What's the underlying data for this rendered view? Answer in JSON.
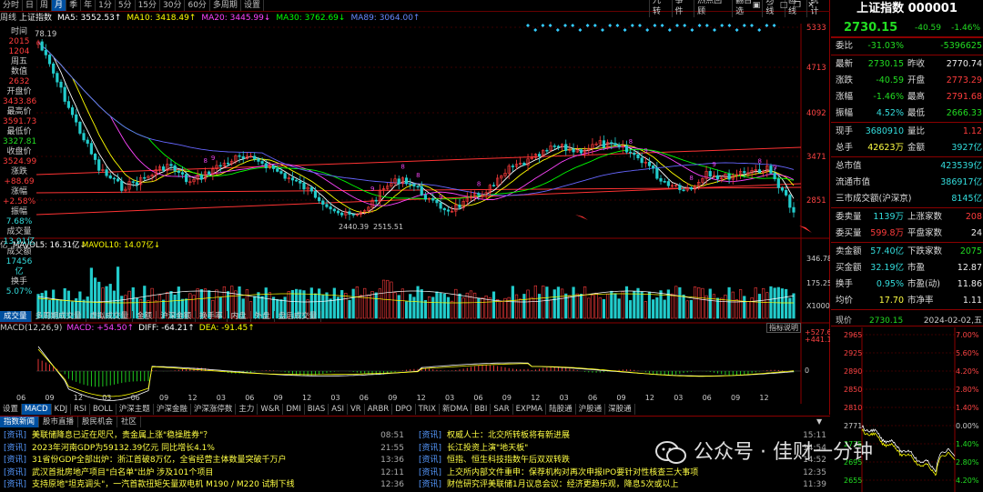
{
  "period_tabs": [
    "分时",
    "日",
    "周",
    "月",
    "季",
    "年",
    "1分",
    "5分",
    "15分",
    "30分",
    "60分",
    "多周期",
    "设置"
  ],
  "period_active": 3,
  "top_tools": [
    "九转",
    "事件",
    "热点回顾",
    "翻自选",
    "均线",
    "画线",
    "统计"
  ],
  "window_icons": [
    "menu-icon",
    "minimize-icon",
    "maximize-icon",
    "restore-icon",
    "close-icon"
  ],
  "ma_legend": {
    "prefix": "周线",
    "title": "上证指数",
    "ma5": "MA5: 3552.53↑",
    "ma10": "MA10: 3418.49↑",
    "ma20": "MA20: 3445.99↓",
    "ma30": "MA30: 3762.69↓",
    "ma89": "MA89: 3064.00↑"
  },
  "info_panel": [
    {
      "label": "时间",
      "value": "2015"
    },
    {
      "label": "",
      "value": "1204"
    },
    {
      "label": "周五",
      "value": ""
    },
    {
      "label": "数值",
      "value": "2632"
    },
    {
      "label": "开盘价",
      "value": "3433.86"
    },
    {
      "label": "最高价",
      "value": "3591.73"
    },
    {
      "label": "最低价",
      "value": "3327.81"
    },
    {
      "label": "收盘价",
      "value": "3524.99"
    },
    {
      "label": "涨跌",
      "value": "+88.69"
    },
    {
      "label": "涨幅",
      "value": "+2.58%"
    },
    {
      "label": "振幅",
      "value": "7.68%"
    },
    {
      "label": "成交量",
      "value": "13.91亿"
    },
    {
      "label": "成交额",
      "value": "17456亿"
    },
    {
      "label": "换手",
      "value": "5.07%"
    }
  ],
  "price_axis": [
    "5333",
    "4713",
    "4092",
    "3471",
    "2851"
  ],
  "price_top_label": "78.19",
  "low_label": "2440.39",
  "low_label2": "2515.51",
  "vol_legend": {
    "prefix": "亿",
    "mavol5": "MAVOL5: 16.31亿↓",
    "mavol10": "MAVOL10: 14.07亿↓"
  },
  "vol_axis": [
    "346.78",
    "175.25"
  ],
  "vol_unit": "X1000",
  "indicator_tabs": [
    "成交量",
    "多周期成交量",
    "虚拟成交量",
    "金额",
    "沪深金额",
    "换手率",
    "内盘",
    "外盘",
    "盘后成交量"
  ],
  "macd_legend": {
    "name": "MACD(12,26,9)",
    "macd": "MACD: +54.50↑",
    "diff": "DIFF: -64.21↑",
    "dea": "DEA: -91.45↑"
  },
  "macd_axis": [
    "+527.6",
    "+441.1",
    "0"
  ],
  "indicator_button": "指标说明",
  "x_axis_labels": [
    "06",
    "09",
    "12",
    "03",
    "06",
    "09",
    "12",
    "03",
    "06",
    "09",
    "12",
    "03",
    "06",
    "09",
    "12",
    "03",
    "06",
    "09",
    "12",
    "03",
    "06",
    "09",
    "12",
    "03",
    "06",
    "09",
    "12"
  ],
  "bottom_tabs": [
    "设置",
    "MACD",
    "KDJ",
    "RSI",
    "BOLL",
    "沪深主题",
    "沪深金融",
    "沪深涨停数",
    "主力",
    "W&R",
    "DMI",
    "BIAS",
    "ASI",
    "VR",
    "ARBR",
    "DPO",
    "TRIX",
    "新DMA",
    "BBI",
    "SAR",
    "EXPMA",
    "陆股通",
    "沪股通",
    "深股通"
  ],
  "bottom_active": 1,
  "right_panel": {
    "title": "上证指数 000001",
    "price": "2730.15",
    "change": "-40.59",
    "change_pct": "-1.46%",
    "rows": [
      {
        "l": "委比",
        "v1": "-31.03%",
        "c1": "grn",
        "l2": "",
        "v2": "-5396625",
        "c2": "grn"
      },
      {
        "l": "最新",
        "v1": "2730.15",
        "c1": "grn",
        "l2": "昨收",
        "v2": "2770.74",
        "c2": "wht"
      },
      {
        "l": "涨跌",
        "v1": "-40.59",
        "c1": "grn",
        "l2": "开盘",
        "v2": "2773.29",
        "c2": "red"
      },
      {
        "l": "涨幅",
        "v1": "-1.46%",
        "c1": "grn",
        "l2": "最高",
        "v2": "2791.68",
        "c2": "red"
      },
      {
        "l": "振幅",
        "v1": "4.52%",
        "c1": "cyan",
        "l2": "最低",
        "v2": "2666.33",
        "c2": "grn"
      },
      {
        "l": "现手",
        "v1": "3680910",
        "c1": "cyan",
        "l2": "量比",
        "v2": "1.12",
        "c2": "red"
      },
      {
        "l": "总手",
        "v1": "42623万",
        "c1": "yel",
        "l2": "金额",
        "v2": "3927亿",
        "c2": "cyan"
      },
      {
        "l": "总市值",
        "v1": "",
        "c1": "wht",
        "l2": "",
        "v2": "423539亿",
        "c2": "cyan"
      },
      {
        "l": "流通市值",
        "v1": "",
        "c1": "wht",
        "l2": "",
        "v2": "386917亿",
        "c2": "cyan"
      },
      {
        "l": "三市成交额(沪深京)",
        "v1": "",
        "c1": "wht",
        "l2": "",
        "v2": "8145亿",
        "c2": "cyan"
      },
      {
        "l": "委卖量",
        "v1": "1139万",
        "c1": "cyan",
        "l2": "上涨家数",
        "v2": "208",
        "c2": "red"
      },
      {
        "l": "委买量",
        "v1": "599.8万",
        "c1": "red",
        "l2": "平盘家数",
        "v2": "24",
        "c2": "wht"
      },
      {
        "l": "卖金额",
        "v1": "57.40亿",
        "c1": "cyan",
        "l2": "下跌家数",
        "v2": "2075",
        "c2": "grn"
      },
      {
        "l": "买金额",
        "v1": "32.19亿",
        "c1": "cyan",
        "l2": "市盈",
        "v2": "12.87",
        "c2": "wht"
      },
      {
        "l": "换手",
        "v1": "0.95%",
        "c1": "cyan",
        "l2": "市盈(动)",
        "v2": "11.86",
        "c2": "wht"
      },
      {
        "l": "均价",
        "v1": "17.70",
        "c1": "yel",
        "l2": "市净率",
        "v2": "1.11",
        "c2": "wht"
      }
    ],
    "mini_header": {
      "l": "现价",
      "v": "2730.15",
      "date": "2024-02-02,五"
    },
    "mini_left": [
      "2965",
      "2925",
      "2890",
      "2850",
      "2810",
      "2771",
      "2735",
      "2695",
      "2655"
    ],
    "mini_right": [
      "7.00%",
      "5.60%",
      "4.20%",
      "2.80%",
      "1.40%",
      "0.00%",
      "1.40%",
      "2.80%",
      "4.20%"
    ]
  },
  "news_tabs": [
    "指数新闻",
    "股市直播",
    "股民机会",
    "社区"
  ],
  "news_left": [
    {
      "tag": "[资讯]",
      "text": "美联储降息已近在咫尺，贵金属上涨\"稳操胜券\"？",
      "time": "08:51"
    },
    {
      "tag": "[资讯]",
      "text": "2023年河南GDP为59132.39亿元 同比增长4.1%",
      "time": "21:55"
    },
    {
      "tag": "[资讯]",
      "text": "31省份GDP全部出炉：浙江首破8万亿，全省经营主体数量突破千万户",
      "time": "13:36"
    },
    {
      "tag": "[资讯]",
      "text": "武汉首批房地产项目\"白名单\"出炉 涉及101个项目",
      "time": "12:11"
    },
    {
      "tag": "[资讯]",
      "text": "支持原地\"坦克调头\"，一汽首款扭矩矢量双电机 M190 / M220 试制下线",
      "time": "12:36"
    }
  ],
  "news_right": [
    {
      "tag": "[资讯]",
      "text": "权威人士：北交所转板将有新进展",
      "time": "15:11"
    },
    {
      "tag": "[资讯]",
      "text": "长江投资上演\"地天板\"",
      "time": "14:54"
    },
    {
      "tag": "[资讯]",
      "text": "恒指、恒生科技指数午后双双转跌",
      "time": "14:52"
    },
    {
      "tag": "[资讯]",
      "text": "上交所内部文件重申：保荐机构对再次申报IPO要针对性核查三大事项",
      "time": "12:35"
    },
    {
      "tag": "[资讯]",
      "text": "财信研究评美联储1月议息会议：经济更趋乐观，降息5次或以上",
      "time": "11:39"
    }
  ],
  "watermark": "公众号 · 佳财一分钟",
  "colors": {
    "ma5": "#ffffff",
    "ma10": "#ffff00",
    "ma20": "#ff44ff",
    "ma30": "#00ff00",
    "ma89": "#6666ff",
    "up": "#ff3c3c",
    "down": "#22cccc",
    "frame": "#8b0000"
  }
}
